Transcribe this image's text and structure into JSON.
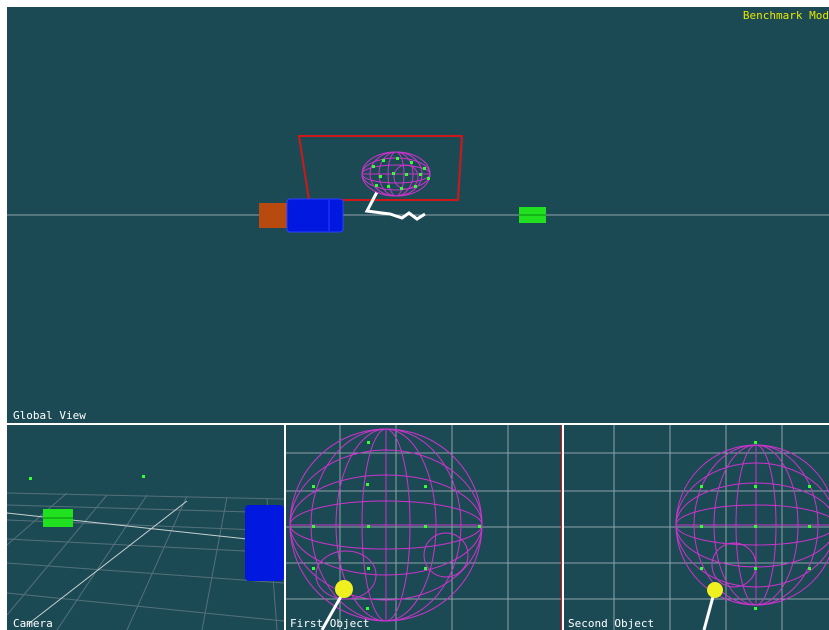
{
  "app": {
    "mode_label": "Benchmark Mod"
  },
  "viewports": {
    "global": {
      "label": "Global View"
    },
    "camera": {
      "label": "Camera"
    },
    "first": {
      "label": "First Object"
    },
    "second": {
      "label": "Second Object"
    }
  },
  "colors": {
    "background": "#1b4a55",
    "grid": "#8fa3a8",
    "wireframe": "#cc33cc",
    "marker": "#33ff33",
    "selection_frame": "#d01818",
    "probe": "#f0f020",
    "box_blue": "#0018e0",
    "box_orange": "#b84a10",
    "box_green": "#20e020",
    "mode_text": "#e8e800"
  }
}
